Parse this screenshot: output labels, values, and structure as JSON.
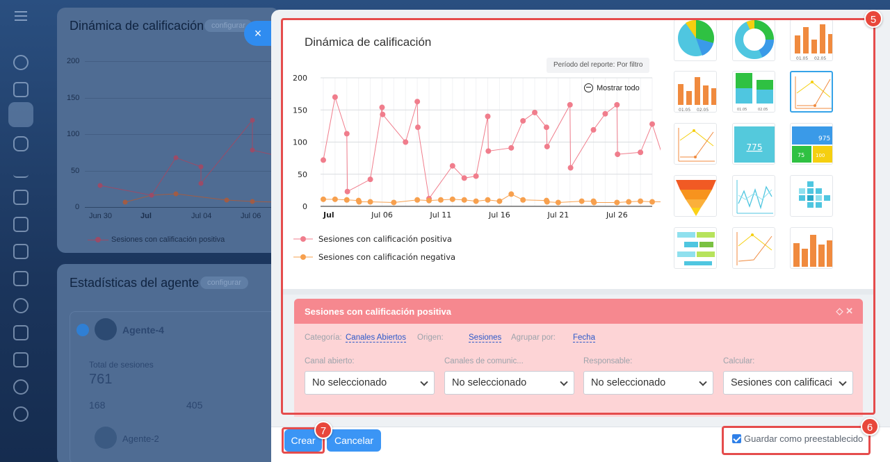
{
  "background": {
    "card1": {
      "title": "Dinámica de calificación",
      "configure": "configurar",
      "y_ticks": [
        "200",
        "150",
        "100",
        "50",
        "0"
      ],
      "x_ticks": [
        "Jun 30",
        "Jul",
        "Jul 04",
        "Jul 06"
      ],
      "legend": "Sesiones con calificación positiva"
    },
    "card2": {
      "title": "Estadísticas del agente",
      "configure": "configurar",
      "agent1": "Agente-4",
      "total_label": "Total de sesiones",
      "total_value": "761",
      "sub_value1": "168",
      "sub_value2": "405",
      "agent2": "Agente-2"
    }
  },
  "dialog": {
    "close_icon": "×",
    "badges": {
      "editor": "5",
      "save_preset": "6",
      "create": "7"
    },
    "chart_title": "Dinámica de calificación",
    "period": "Período del reporte: Por filtro",
    "show_all": "Mostrar todo",
    "series_title": "Sesiones con calificación positiva",
    "filters": {
      "category_label": "Categoría:",
      "category_value": "Canales Abiertos",
      "origin_label": "Origen:",
      "origin_value": "Sesiones",
      "group_label": "Agrupar por:",
      "group_value": "Fecha"
    },
    "fields": [
      {
        "label": "Canal abierto:",
        "value": "No seleccionado"
      },
      {
        "label": "Canales de comunic...",
        "value": "No seleccionado"
      },
      {
        "label": "Responsable:",
        "value": "No seleccionado"
      },
      {
        "label": "Calcular:",
        "value": "Sesiones con calificaci"
      }
    ],
    "thumbnails": {
      "thumb_label_a": "01.05",
      "thumb_label_b": "02.05",
      "number_tile": "775",
      "stat_tile_main": "975",
      "stat_tile_a": "75",
      "stat_tile_b": "100"
    },
    "footer": {
      "create": "Crear",
      "cancel": "Cancelar",
      "save_preset": "Guardar como preestablecido"
    }
  },
  "chart_data": {
    "type": "line",
    "title": "Dinámica de calificación",
    "x": [
      "Jul 1",
      "Jul 2",
      "Jul 3",
      "Jul 4",
      "Jul 5",
      "Jul 6",
      "Jul 7",
      "Jul 8",
      "Jul 9",
      "Jul 10",
      "Jul 11",
      "Jul 12",
      "Jul 13",
      "Jul 14",
      "Jul 15",
      "Jul 16",
      "Jul 17",
      "Jul 18",
      "Jul 19",
      "Jul 20",
      "Jul 21",
      "Jul 22",
      "Jul 23",
      "Jul 24",
      "Jul 25",
      "Jul 26",
      "Jul 27",
      "Jul 28",
      "Jul 29"
    ],
    "x_tick_labels": [
      "Jul",
      "Jul 06",
      "Jul 11",
      "Jul 16",
      "Jul 21",
      "Jul 26"
    ],
    "y_ticks": [
      0,
      50,
      100,
      150,
      200
    ],
    "ylim": [
      0,
      210
    ],
    "series": [
      {
        "name": "Sesiones con calificación positiva",
        "color": "#f07d8c",
        "points": [
          [
            0,
            72
          ],
          [
            1,
            170
          ],
          [
            2,
            113
          ],
          [
            2.05,
            23
          ],
          [
            4,
            42
          ],
          [
            5,
            154
          ],
          [
            5.05,
            143
          ],
          [
            7,
            100
          ],
          [
            8,
            163
          ],
          [
            8.05,
            123
          ],
          [
            9,
            12
          ],
          [
            11,
            63
          ],
          [
            12,
            44
          ],
          [
            13,
            47
          ],
          [
            14,
            140
          ],
          [
            14.05,
            86
          ],
          [
            16,
            91
          ],
          [
            17,
            133
          ],
          [
            18,
            146
          ],
          [
            19,
            123
          ],
          [
            19.05,
            93
          ],
          [
            21,
            158
          ],
          [
            21.05,
            60
          ],
          [
            23,
            119
          ],
          [
            24,
            144
          ],
          [
            25,
            158
          ],
          [
            25.05,
            81
          ],
          [
            27,
            84
          ],
          [
            28,
            128
          ],
          [
            29,
            72
          ]
        ]
      },
      {
        "name": "Sesiones con calificación negativa",
        "color": "#f7a04e",
        "points": [
          [
            0,
            11
          ],
          [
            1,
            11
          ],
          [
            2,
            10
          ],
          [
            3,
            9
          ],
          [
            3.05,
            7
          ],
          [
            4,
            7
          ],
          [
            6,
            6
          ],
          [
            8,
            10
          ],
          [
            9,
            9
          ],
          [
            10,
            10
          ],
          [
            11,
            11
          ],
          [
            12,
            10
          ],
          [
            13,
            8
          ],
          [
            14,
            10
          ],
          [
            15,
            8
          ],
          [
            16,
            19
          ],
          [
            17,
            10
          ],
          [
            19,
            9
          ],
          [
            19.05,
            7
          ],
          [
            20,
            6
          ],
          [
            22,
            8
          ],
          [
            23,
            8
          ],
          [
            23.05,
            6
          ],
          [
            25,
            6
          ],
          [
            26,
            7
          ],
          [
            27,
            8
          ],
          [
            28,
            7
          ],
          [
            29,
            7
          ]
        ]
      }
    ],
    "grid": true,
    "legend": "bottom-left"
  }
}
